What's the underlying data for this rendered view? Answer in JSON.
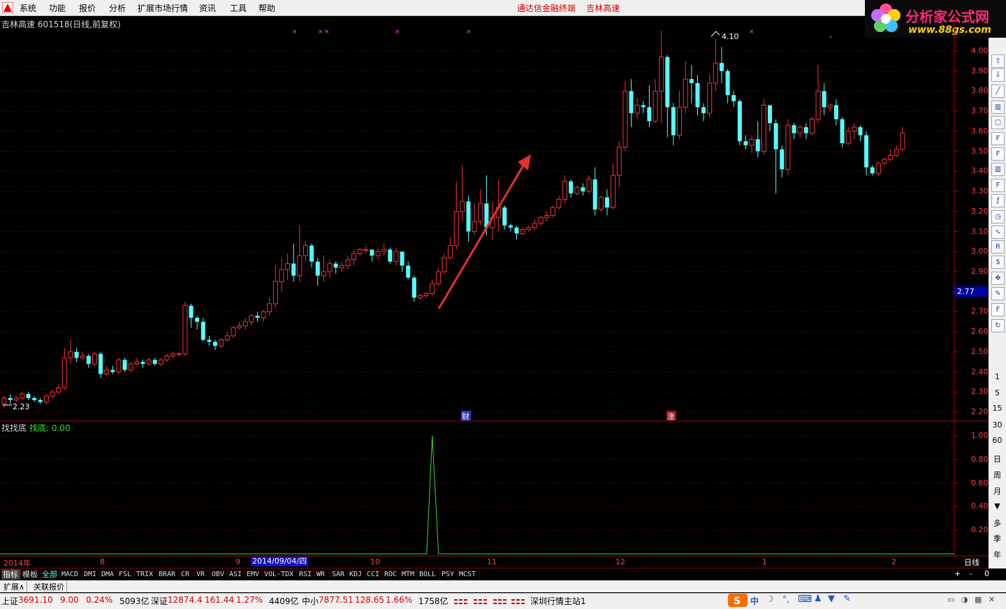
{
  "menu": {
    "items": [
      "系统",
      "功能",
      "报价",
      "分析",
      "扩展市场行情",
      "资讯",
      "工具",
      "帮助"
    ],
    "center_title": "通达信金融终端    吉林高速",
    "brand_name": "分析家公式网",
    "brand_url": "www.88gs.com"
  },
  "stock": {
    "title": "吉林高速 601518(日线,前复权)",
    "high_label": "4.10",
    "low_label": "2.23",
    "current_price": "2.77",
    "marker_finance": "财",
    "marker_rise": "涨"
  },
  "price_axis": {
    "ticks": [
      "4.00",
      "3.90",
      "3.80",
      "3.70",
      "3.60",
      "3.50",
      "3.40",
      "3.30",
      "3.20",
      "3.10",
      "3.00",
      "2.90",
      "2.70",
      "2.60",
      "2.50",
      "2.40",
      "2.30",
      "2.20"
    ]
  },
  "indicator": {
    "name": "找找底",
    "value_label": "找底: 0.00",
    "ticks": [
      "1.00",
      "0.80",
      "0.60",
      "0.40",
      "0.20"
    ]
  },
  "date_axis": {
    "labels": [
      "2014年",
      "8",
      "9",
      "10",
      "11",
      "12",
      "1",
      "2"
    ],
    "cursor": "2014/09/04/四",
    "period": "日线"
  },
  "indicator_tabs": [
    "指标",
    "模板",
    "全部",
    "MACD",
    "DMI",
    "DMA",
    "FSL",
    "TRIX",
    "BRAR",
    "CR",
    "VR",
    "OBV",
    "ASI",
    "EMV",
    "VOL-TDX",
    "RSI",
    "WR",
    "SAR",
    "KDJ",
    "CCI",
    "ROC",
    "MTM",
    "BOLL",
    "PSY",
    "MCST"
  ],
  "zoom": [
    "+",
    "-",
    "0"
  ],
  "ext_tabs": [
    "扩展∧",
    "关联报价"
  ],
  "status": {
    "sh_label": "上证",
    "sh_value": "3691.10",
    "sh_change": "9.00",
    "sh_pct": "0.24%",
    "sh_amount": "5093亿",
    "sz_label": "深证",
    "sz_value": "12874.4",
    "sz_change": "161.44",
    "sz_pct": "1.27%",
    "sz_amount": "4409亿",
    "zx_label": "中小",
    "zx_value": "7877.51",
    "zx_change": "128.65",
    "zx_pct": "1.66%",
    "zx_amount": "1758亿",
    "server": "深圳行情主站1",
    "ime_char": "中"
  },
  "right_toolbar": {
    "periods": [
      "1",
      "5",
      "15",
      "30",
      "60",
      "日",
      "周",
      "月",
      "多",
      "季",
      "年"
    ]
  },
  "chart_data": {
    "type": "candlestick",
    "ylim": [
      2.15,
      4.1
    ],
    "candles": [
      [
        2.24,
        2.27,
        2.22,
        2.28
      ],
      [
        2.27,
        2.26,
        2.24,
        2.29
      ],
      [
        2.26,
        2.27,
        2.25,
        2.28
      ],
      [
        2.27,
        2.29,
        2.26,
        2.3
      ],
      [
        2.29,
        2.27,
        2.26,
        2.3
      ],
      [
        2.27,
        2.26,
        2.25,
        2.28
      ],
      [
        2.26,
        2.25,
        2.24,
        2.27
      ],
      [
        2.25,
        2.28,
        2.24,
        2.29
      ],
      [
        2.28,
        2.3,
        2.27,
        2.31
      ],
      [
        2.3,
        2.32,
        2.29,
        2.34
      ],
      [
        2.32,
        2.47,
        2.31,
        2.52
      ],
      [
        2.47,
        2.5,
        2.44,
        2.56
      ],
      [
        2.5,
        2.47,
        2.45,
        2.52
      ],
      [
        2.47,
        2.48,
        2.46,
        2.5
      ],
      [
        2.48,
        2.44,
        2.42,
        2.49
      ],
      [
        2.44,
        2.49,
        2.43,
        2.5
      ],
      [
        2.49,
        2.39,
        2.37,
        2.5
      ],
      [
        2.39,
        2.41,
        2.38,
        2.43
      ],
      [
        2.41,
        2.4,
        2.39,
        2.43
      ],
      [
        2.4,
        2.46,
        2.39,
        2.47
      ],
      [
        2.46,
        2.41,
        2.4,
        2.47
      ],
      [
        2.41,
        2.44,
        2.4,
        2.45
      ],
      [
        2.44,
        2.45,
        2.43,
        2.47
      ],
      [
        2.45,
        2.44,
        2.42,
        2.46
      ],
      [
        2.44,
        2.46,
        2.43,
        2.47
      ],
      [
        2.46,
        2.44,
        2.43,
        2.47
      ],
      [
        2.44,
        2.46,
        2.43,
        2.47
      ],
      [
        2.46,
        2.48,
        2.45,
        2.49
      ],
      [
        2.48,
        2.49,
        2.47,
        2.5
      ],
      [
        2.49,
        2.49,
        2.48,
        2.5
      ],
      [
        2.49,
        2.73,
        2.48,
        2.75
      ],
      [
        2.73,
        2.67,
        2.62,
        2.74
      ],
      [
        2.67,
        2.65,
        2.61,
        2.68
      ],
      [
        2.65,
        2.56,
        2.55,
        2.67
      ],
      [
        2.56,
        2.55,
        2.53,
        2.58
      ],
      [
        2.55,
        2.53,
        2.51,
        2.56
      ],
      [
        2.53,
        2.56,
        2.52,
        2.57
      ],
      [
        2.56,
        2.58,
        2.55,
        2.6
      ],
      [
        2.58,
        2.62,
        2.57,
        2.63
      ],
      [
        2.62,
        2.63,
        2.61,
        2.65
      ],
      [
        2.63,
        2.65,
        2.61,
        2.67
      ],
      [
        2.65,
        2.68,
        2.63,
        2.69
      ],
      [
        2.68,
        2.67,
        2.65,
        2.7
      ],
      [
        2.67,
        2.7,
        2.65,
        2.71
      ],
      [
        2.7,
        2.74,
        2.68,
        2.77
      ],
      [
        2.74,
        2.85,
        2.72,
        2.93
      ],
      [
        2.85,
        2.91,
        2.8,
        2.97
      ],
      [
        2.91,
        2.94,
        2.86,
        2.99
      ],
      [
        2.94,
        2.88,
        2.85,
        3.04
      ],
      [
        2.88,
        2.98,
        2.85,
        3.13
      ],
      [
        2.98,
        3.03,
        2.95,
        3.05
      ],
      [
        3.03,
        2.95,
        2.92,
        3.04
      ],
      [
        2.95,
        2.88,
        2.83,
        2.97
      ],
      [
        2.88,
        2.9,
        2.85,
        2.98
      ],
      [
        2.9,
        2.94,
        2.87,
        2.96
      ],
      [
        2.94,
        2.92,
        2.89,
        2.95
      ],
      [
        2.92,
        2.93,
        2.9,
        2.95
      ],
      [
        2.93,
        2.96,
        2.91,
        2.98
      ],
      [
        2.96,
        2.99,
        2.93,
        3.01
      ],
      [
        2.99,
        3.01,
        2.98,
        3.02
      ],
      [
        3.01,
        3.01,
        2.99,
        3.03
      ],
      [
        3.01,
        2.98,
        2.95,
        3.0
      ],
      [
        2.98,
        3.0,
        2.96,
        3.02
      ],
      [
        3.0,
        3.01,
        2.98,
        3.04
      ],
      [
        3.01,
        2.95,
        2.94,
        3.02
      ],
      [
        2.95,
        3.0,
        2.93,
        3.02
      ],
      [
        3.0,
        2.93,
        2.9,
        3.0
      ],
      [
        2.93,
        2.87,
        2.86,
        2.95
      ],
      [
        2.87,
        2.77,
        2.75,
        2.88
      ],
      [
        2.77,
        2.78,
        2.76,
        2.79
      ],
      [
        2.78,
        2.79,
        2.77,
        2.8
      ],
      [
        2.79,
        2.84,
        2.78,
        2.86
      ],
      [
        2.84,
        2.9,
        2.83,
        2.92
      ],
      [
        2.9,
        2.97,
        2.89,
        2.99
      ],
      [
        2.97,
        3.03,
        2.96,
        3.07
      ],
      [
        3.03,
        3.2,
        3.01,
        3.35
      ],
      [
        3.2,
        3.25,
        3.15,
        3.43
      ],
      [
        3.25,
        3.1,
        3.05,
        3.28
      ],
      [
        3.1,
        3.15,
        3.08,
        3.24
      ],
      [
        3.15,
        3.24,
        3.13,
        3.31
      ],
      [
        3.24,
        3.12,
        3.08,
        3.38
      ],
      [
        3.12,
        3.17,
        3.06,
        3.25
      ],
      [
        3.17,
        3.22,
        3.1,
        3.36
      ],
      [
        3.22,
        3.13,
        3.11,
        3.23
      ],
      [
        3.13,
        3.12,
        3.1,
        3.14
      ],
      [
        3.12,
        3.09,
        3.06,
        3.13
      ],
      [
        3.09,
        3.11,
        3.08,
        3.12
      ],
      [
        3.11,
        3.12,
        3.1,
        3.13
      ],
      [
        3.12,
        3.14,
        3.11,
        3.16
      ],
      [
        3.14,
        3.17,
        3.13,
        3.18
      ],
      [
        3.17,
        3.18,
        3.15,
        3.2
      ],
      [
        3.18,
        3.22,
        3.17,
        3.23
      ],
      [
        3.22,
        3.26,
        3.21,
        3.28
      ],
      [
        3.26,
        3.35,
        3.24,
        3.38
      ],
      [
        3.35,
        3.29,
        3.27,
        3.36
      ],
      [
        3.29,
        3.32,
        3.28,
        3.33
      ],
      [
        3.32,
        3.3,
        3.28,
        3.34
      ],
      [
        3.3,
        3.36,
        3.29,
        3.38
      ],
      [
        3.36,
        3.21,
        3.18,
        3.42
      ],
      [
        3.21,
        3.27,
        3.2,
        3.28
      ],
      [
        3.27,
        3.22,
        3.18,
        3.31
      ],
      [
        3.22,
        3.38,
        3.21,
        3.44
      ],
      [
        3.38,
        3.52,
        3.32,
        3.55
      ],
      [
        3.52,
        3.8,
        3.5,
        3.85
      ],
      [
        3.8,
        3.69,
        3.62,
        3.86
      ],
      [
        3.69,
        3.73,
        3.66,
        3.77
      ],
      [
        3.73,
        3.72,
        3.69,
        3.75
      ],
      [
        3.72,
        3.65,
        3.62,
        3.83
      ],
      [
        3.65,
        3.8,
        3.64,
        3.86
      ],
      [
        3.8,
        3.97,
        3.64,
        4.1
      ],
      [
        3.97,
        3.72,
        3.57,
        3.98
      ],
      [
        3.72,
        3.58,
        3.53,
        3.74
      ],
      [
        3.58,
        3.72,
        3.56,
        3.8
      ],
      [
        3.72,
        3.86,
        3.69,
        3.95
      ],
      [
        3.86,
        3.84,
        3.74,
        3.93
      ],
      [
        3.84,
        3.72,
        3.68,
        3.88
      ],
      [
        3.72,
        3.69,
        3.65,
        3.74
      ],
      [
        3.69,
        3.84,
        3.67,
        3.88
      ],
      [
        3.84,
        3.94,
        3.8,
        4.06
      ],
      [
        3.94,
        3.9,
        3.84,
        4.02
      ],
      [
        3.9,
        3.78,
        3.74,
        3.91
      ],
      [
        3.78,
        3.75,
        3.72,
        3.8
      ],
      [
        3.75,
        3.55,
        3.53,
        3.76
      ],
      [
        3.55,
        3.53,
        3.51,
        3.58
      ],
      [
        3.53,
        3.56,
        3.49,
        3.58
      ],
      [
        3.56,
        3.5,
        3.47,
        3.65
      ],
      [
        3.5,
        3.73,
        3.48,
        3.76
      ],
      [
        3.73,
        3.64,
        3.6,
        3.7
      ],
      [
        3.64,
        3.51,
        3.29,
        3.66
      ],
      [
        3.51,
        3.41,
        3.37,
        3.53
      ],
      [
        3.41,
        3.63,
        3.38,
        3.66
      ],
      [
        3.63,
        3.59,
        3.56,
        3.64
      ],
      [
        3.59,
        3.62,
        3.57,
        3.63
      ],
      [
        3.62,
        3.59,
        3.56,
        3.64
      ],
      [
        3.59,
        3.66,
        3.58,
        3.67
      ],
      [
        3.66,
        3.8,
        3.64,
        3.93
      ],
      [
        3.8,
        3.72,
        3.68,
        3.84
      ],
      [
        3.72,
        3.73,
        3.7,
        3.74
      ],
      [
        3.73,
        3.66,
        3.63,
        3.76
      ],
      [
        3.66,
        3.54,
        3.52,
        3.67
      ],
      [
        3.54,
        3.6,
        3.53,
        3.62
      ],
      [
        3.6,
        3.62,
        3.56,
        3.64
      ],
      [
        3.62,
        3.58,
        3.55,
        3.63
      ],
      [
        3.58,
        3.42,
        3.38,
        3.6
      ],
      [
        3.42,
        3.39,
        3.38,
        3.43
      ],
      [
        3.39,
        3.44,
        3.38,
        3.45
      ],
      [
        3.44,
        3.46,
        3.43,
        3.47
      ],
      [
        3.46,
        3.48,
        3.45,
        3.51
      ],
      [
        3.48,
        3.51,
        3.47,
        3.53
      ],
      [
        3.51,
        3.59,
        3.5,
        3.62
      ]
    ],
    "indicator_series": {
      "name": "找底",
      "spike_index": 71,
      "spike_value": 1.0
    }
  }
}
